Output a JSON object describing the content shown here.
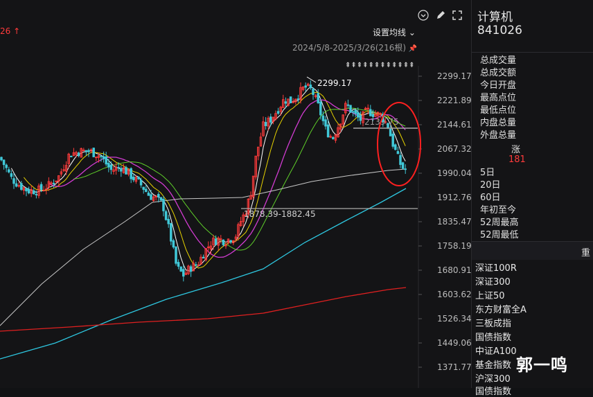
{
  "toolbar": {
    "top_left_label": "26 ↑",
    "ma_settings_label": "设置均线 ⌄",
    "date_range": "2024/5/8-2025/3/26(216根)",
    "pin_glyph": "📌"
  },
  "chart": {
    "yaxis_labels": [
      "2299.17",
      "2221.89",
      "2144.61",
      "2067.32",
      "1990.04",
      "1912.76",
      "1835.47",
      "1758.19",
      "1680.91",
      "1603.62",
      "1526.34",
      "1449.06",
      "1371.77"
    ],
    "high_label": "2299.17",
    "low_range_label": "1878.39-1882.45",
    "hline_label": "2139.75",
    "arrows_glyph": "⇞⇞⇞⇞⇞⇞⇞⇞⇞⇞⇞⇞"
  },
  "panel": {
    "name": "计算机",
    "code": "841026",
    "stats": [
      "总成交量",
      "总成交额",
      "今日开盘",
      "最高点位",
      "最低点位",
      "内盘总量",
      "外盘总量"
    ],
    "zhang_label": "涨",
    "zhang_value": "181",
    "periods": [
      "5日",
      "20日",
      "60日",
      "年初至今",
      "52周最高",
      "52周最低"
    ],
    "related_header": "重",
    "related": [
      "深证100R",
      "深证300",
      "上证50",
      "东方财富全A",
      "三板成指",
      "国债指数",
      "中证A100",
      "基金指数",
      "沪深300",
      "国债指数"
    ]
  },
  "watermark": "郭一鸣",
  "chart_data": {
    "type": "candlestick",
    "title": "",
    "y_axis_ticks": [
      2299.17,
      2221.89,
      2144.61,
      2067.32,
      1990.04,
      1912.76,
      1835.47,
      1758.19,
      1680.91,
      1603.62,
      1526.34,
      1449.06,
      1371.77
    ],
    "period": "2024/5/8-2025/3/26",
    "bars": 216,
    "annotations": [
      "2299.17",
      "1878.39-1882.45"
    ]
  }
}
